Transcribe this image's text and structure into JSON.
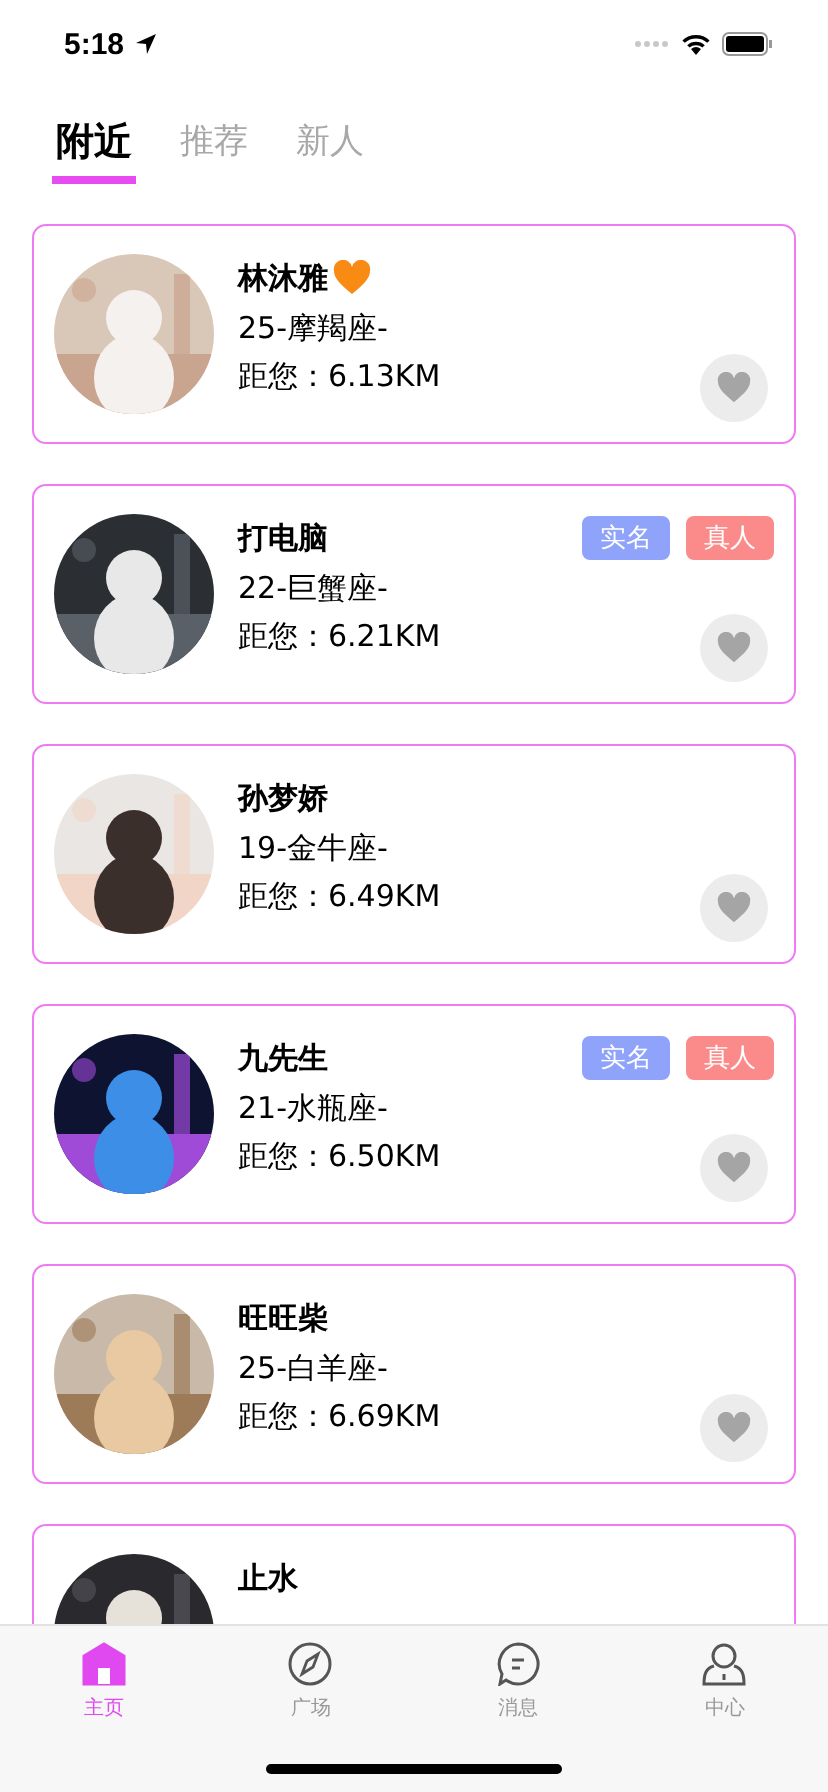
{
  "status_bar": {
    "time": "5:18"
  },
  "tabs": [
    {
      "label": "附近",
      "selected": true
    },
    {
      "label": "推荐",
      "selected": false
    },
    {
      "label": "新人",
      "selected": false
    }
  ],
  "users": [
    {
      "name": "林沐雅",
      "heart_badge": true,
      "info": "25-摩羯座-",
      "distance": "距您：6.13KM"
    },
    {
      "name": "打电脑",
      "heart_badge": false,
      "info": "22-巨蟹座-",
      "distance": "距您：6.21KM",
      "tags": [
        {
          "label": "实名",
          "color": "#8fa3fb"
        },
        {
          "label": "真人",
          "color": "#fb8a8a"
        }
      ]
    },
    {
      "name": "孙梦娇",
      "heart_badge": false,
      "info": "19-金牛座-",
      "distance": "距您：6.49KM"
    },
    {
      "name": "九先生",
      "heart_badge": false,
      "info": "21-水瓶座-",
      "distance": "距您：6.50KM",
      "tags": [
        {
          "label": "实名",
          "color": "#8fa3fb"
        },
        {
          "label": "真人",
          "color": "#fb8a8a"
        }
      ]
    },
    {
      "name": "旺旺柴",
      "heart_badge": false,
      "info": "25-白羊座-",
      "distance": "距您：6.69KM"
    },
    {
      "name": "止水",
      "heart_badge": false
    }
  ],
  "nav": [
    {
      "label": "主页",
      "kind": "home",
      "selected": true
    },
    {
      "label": "广场",
      "kind": "compass",
      "selected": false
    },
    {
      "label": "消息",
      "kind": "chat",
      "selected": false
    },
    {
      "label": "中心",
      "kind": "person",
      "selected": false
    }
  ]
}
